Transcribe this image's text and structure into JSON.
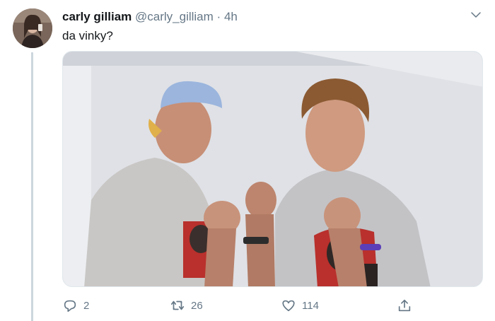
{
  "tweet": {
    "author_name": "carly gilliam",
    "handle": "@carly_gilliam",
    "separator": "·",
    "time": "4h",
    "text": "da vinky?"
  },
  "actions": {
    "reply_count": "2",
    "retweet_count": "26",
    "like_count": "114"
  },
  "media": {
    "description_icon": "photo"
  },
  "colors": {
    "secondary_text": "#657786",
    "thread_line": "#ccd6dd"
  }
}
